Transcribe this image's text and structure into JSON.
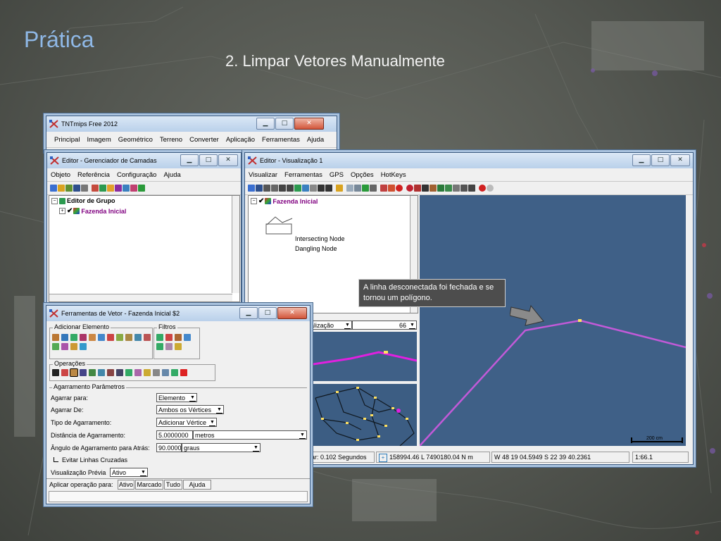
{
  "slide": {
    "title": "Prática",
    "subtitle": "2. Limpar Vetores Manualmente"
  },
  "colors": {
    "title": "#8fb8e6",
    "map_background": "#3f6087",
    "vector_line": "#c25ad8",
    "callout_bg": "#4d4d4d"
  },
  "main_window": {
    "title": "TNTmips Free 2012",
    "menu": [
      "Principal",
      "Imagem",
      "Geométrico",
      "Terreno",
      "Converter",
      "Aplicação",
      "Ferramentas",
      "Ajuda"
    ]
  },
  "layer_manager": {
    "title": "Editor - Gerenciador de Camadas",
    "menu": [
      "Objeto",
      "Referência",
      "Configuração",
      "Ajuda"
    ],
    "tree": {
      "group": "Editor de Grupo",
      "layer": "Fazenda Inicial"
    }
  },
  "view_window": {
    "title": "Editor - Visualização 1",
    "menu": [
      "Visualizar",
      "Ferramentas",
      "GPS",
      "Opções",
      "HotKeys"
    ],
    "tree": {
      "layer": "Fazenda Inicial",
      "legend": [
        "Intersecting Node",
        "Dangling Node"
      ]
    },
    "view_select": "alização",
    "zoom_value": "66",
    "status": {
      "time": "ar: 0.102 Segundos",
      "coords_utm": "158994.46 L  7490180.04 N m",
      "coords_geo": "W 48 19 04.5949  S 22 39 40.2361",
      "scale": "1:66.1"
    },
    "scalebar_label": "200 cm"
  },
  "callout": {
    "text": "A linha desconectada foi fechada e se tornou um polígono."
  },
  "vector_tools": {
    "title": "Ferramentas de Vetor - Fazenda Inicial $2",
    "groups": {
      "add_element": "Adicionar Elemento",
      "filters": "Filtros",
      "operations": "Operações",
      "snap_params": "Agarramento Parâmetros"
    },
    "fields": {
      "snap_to_label": "Agarrar para:",
      "snap_to_value": "Elemento",
      "snap_from_label": "Agarrar De:",
      "snap_from_value": "Ambos os Vértices",
      "snap_type_label": "Tipo de Agarramento:",
      "snap_type_value": "Adicionar Vértice",
      "snap_distance_label": "Distância de Agarramento:",
      "snap_distance_value": "5.0000000",
      "snap_distance_unit": "metros",
      "snap_angle_label": "Ângulo de Agarramento para Atrás:",
      "snap_angle_value": "90.0000",
      "snap_angle_unit": "graus",
      "avoid_crossed_label": "Evitar Linhas Cruzadas",
      "preview_label": "Visualização Prévia",
      "preview_value": "Ativo"
    },
    "apply": {
      "label": "Aplicar operação para:",
      "buttons": [
        "Ativo",
        "Marcado",
        "Tudo",
        "Ajuda"
      ]
    }
  }
}
